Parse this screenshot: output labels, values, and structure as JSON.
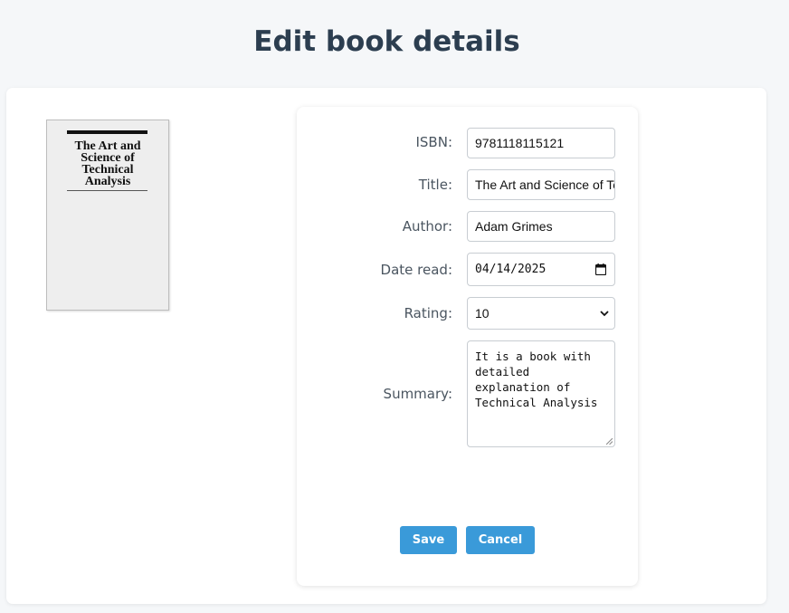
{
  "page": {
    "title": "Edit book details"
  },
  "cover": {
    "title": "The Art and Science of Technical Analysis"
  },
  "form": {
    "isbn": {
      "label": "ISBN:",
      "value": "9781118115121"
    },
    "title": {
      "label": "Title:",
      "value": "The Art and Science of Technical Analysis"
    },
    "author": {
      "label": "Author:",
      "value": "Adam Grimes"
    },
    "date_read": {
      "label": "Date read:",
      "value": "04/14/2025"
    },
    "rating": {
      "label": "Rating:",
      "value": "10"
    },
    "summary": {
      "label": "Summary:",
      "value": "It is a book with detailed explanation of Technical Analysis"
    }
  },
  "actions": {
    "save_label": "Save",
    "cancel_label": "Cancel"
  },
  "colors": {
    "accent": "#3a9ad9",
    "title": "#2c3e50",
    "background": "#f5f7f9"
  },
  "icons": [
    "calendar-icon",
    "chevron-down-icon",
    "resize-handle-icon"
  ]
}
